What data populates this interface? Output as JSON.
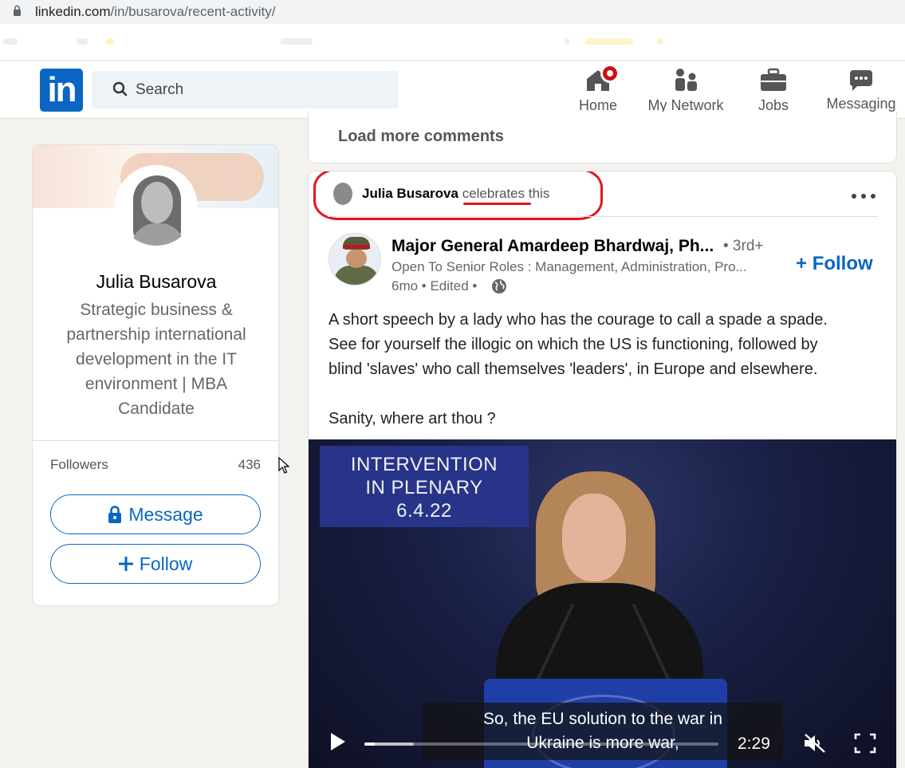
{
  "browser": {
    "url_domain": "linkedin.com",
    "url_path": "/in/busarova/recent-activity/"
  },
  "nav": {
    "logo": "in",
    "search_placeholder": "Search",
    "items": [
      {
        "label": "Home",
        "icon": "home-icon"
      },
      {
        "label": "My Network",
        "icon": "network-icon"
      },
      {
        "label": "Jobs",
        "icon": "briefcase-icon"
      },
      {
        "label": "Messaging",
        "icon": "messaging-icon"
      }
    ],
    "brand_color": "#0a66c2"
  },
  "profile": {
    "name": "Julia Busarova",
    "headline": "Strategic business & partnership international development in the IT environment | MBA Candidate",
    "followers_label": "Followers",
    "followers_count": "436",
    "message_button": "Message",
    "follow_button": "Follow"
  },
  "comments": {
    "load_more": "Load more comments"
  },
  "post": {
    "context_name": "Julia Busarova",
    "context_action": "celebrates",
    "context_suffix": "this",
    "author_name": "Major General Amardeep Bhardwaj, Ph...",
    "degree": "• 3rd+",
    "author_subtitle": "Open To Senior Roles : Management, Administration, Pro...",
    "meta": "6mo • Edited •",
    "follow_label": "Follow",
    "body_lines": [
      "A short speech by a lady who has the courage to call a spade a spade.",
      "See for yourself the illogic on which the US is functioning, followed by",
      "blind 'slaves' who call themselves 'leaders', in Europe and elsewhere."
    ],
    "body_last": "Sanity, where art thou ?",
    "highlight_color": "#e3141c"
  },
  "video": {
    "overlay_lines": [
      "INTERVENTION",
      "IN PLENARY",
      "6.4.22"
    ],
    "subtitle_line1": "So, the EU solution to the war in",
    "subtitle_line2": "Ukraine is more war,",
    "duration": "2:29",
    "progress_fraction": 0.03
  }
}
